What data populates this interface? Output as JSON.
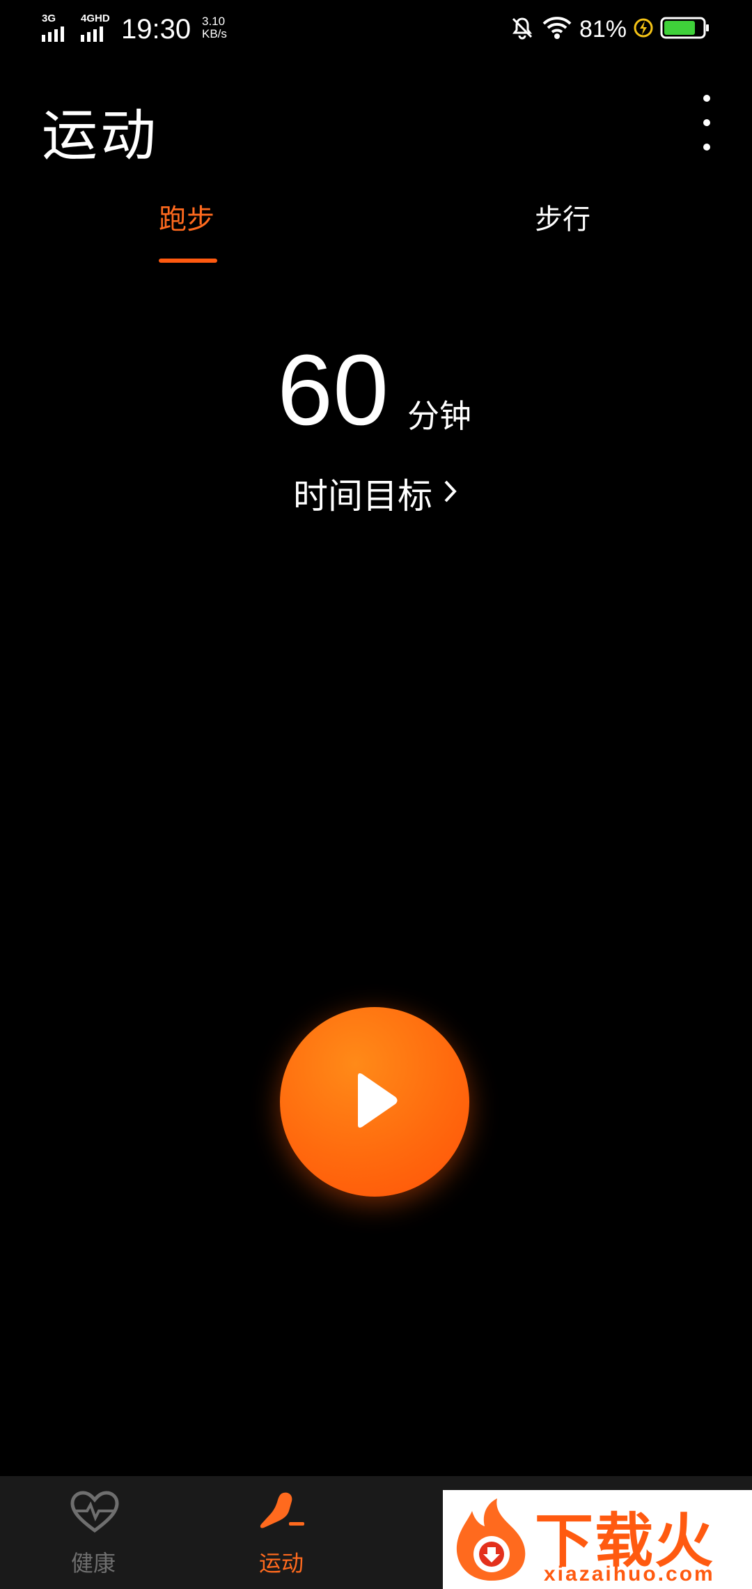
{
  "status_bar": {
    "network_1": "3G",
    "network_2": "4GHD",
    "time": "19:30",
    "speed_value": "3.10",
    "speed_unit": "KB/s",
    "battery_percent": "81%",
    "icons": [
      "bell-muted-icon",
      "wifi-icon",
      "charging-icon",
      "battery-icon"
    ],
    "battery_level": 0.81,
    "battery_color": "#3fd13a"
  },
  "header": {
    "title": "运动",
    "menu_icon": "more-vertical-icon"
  },
  "tabs": [
    {
      "label": "跑步",
      "active": true
    },
    {
      "label": "步行",
      "active": false
    }
  ],
  "goal": {
    "value": "60",
    "unit": "分钟",
    "link_label": "时间目标",
    "link_icon": "chevron-right-icon"
  },
  "start_button": {
    "icon": "play-icon"
  },
  "bottom_nav": [
    {
      "label": "健康",
      "icon": "heart-pulse-icon",
      "active": false
    },
    {
      "label": "运动",
      "icon": "running-shoe-icon",
      "active": true
    }
  ],
  "watermark": {
    "name": "下载火",
    "url": "xiazaihuo.com"
  },
  "colors": {
    "accent": "#ff6a1e",
    "background": "#000000",
    "nav_background": "#1a1a1a",
    "inactive": "#6f6f6f"
  }
}
